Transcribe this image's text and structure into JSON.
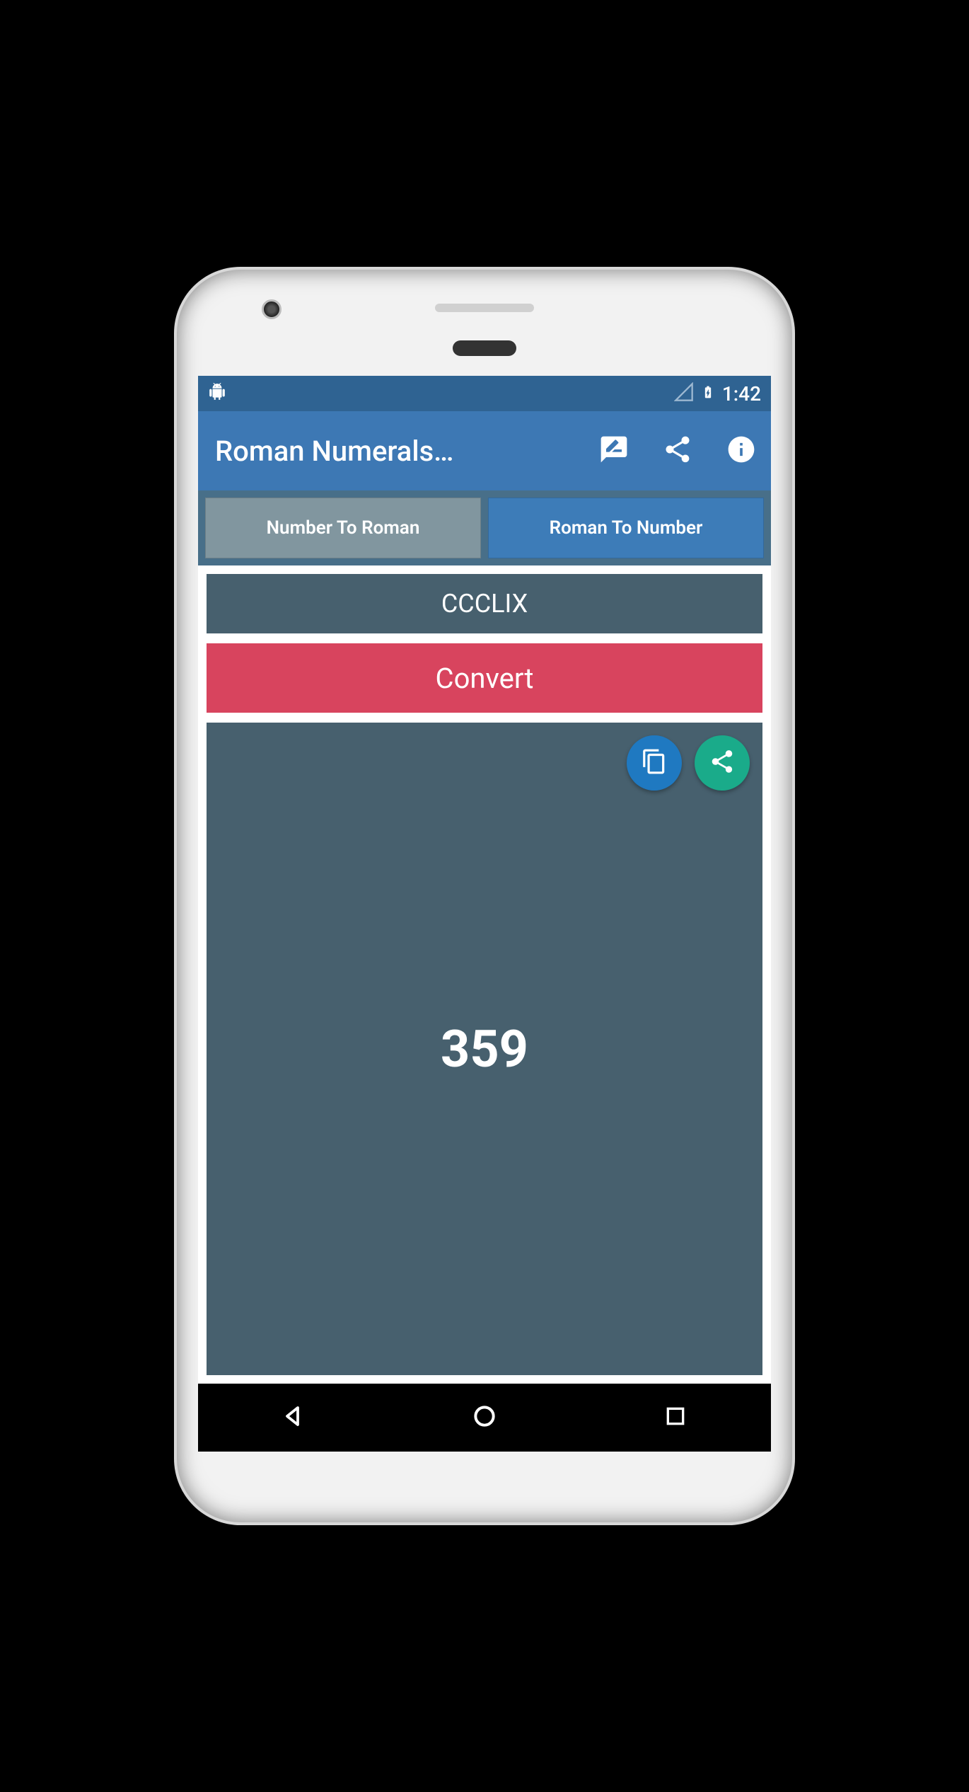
{
  "status": {
    "time": "1:42"
  },
  "appbar": {
    "title": "Roman Numerals…"
  },
  "tabs": {
    "number_to_roman": "Number To Roman",
    "roman_to_number": "Roman To Number"
  },
  "input": {
    "value": "CCCLIX"
  },
  "convert": {
    "label": "Convert"
  },
  "result": {
    "value": "359"
  }
}
